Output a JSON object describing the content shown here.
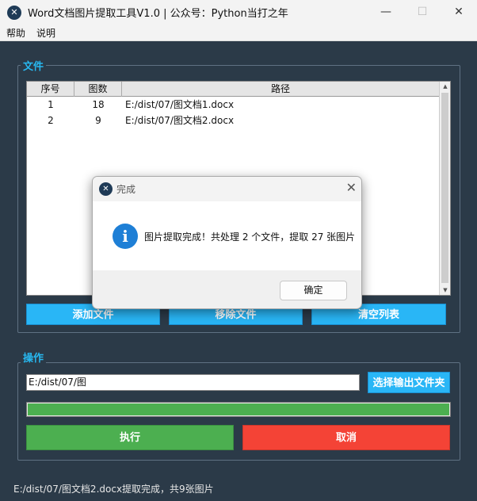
{
  "window": {
    "title": "Word文档图片提取工具V1.0 | 公众号：Python当打之年",
    "app_icon": "app-logo-icon",
    "minimize": "—",
    "maximize": "☐",
    "close": "✕"
  },
  "menu": {
    "items": [
      {
        "label": "帮助"
      },
      {
        "label": "说明"
      }
    ]
  },
  "files_group": {
    "title": "文件",
    "columns": [
      {
        "label": "序号"
      },
      {
        "label": "图数"
      },
      {
        "label": "路径"
      }
    ],
    "rows": [
      {
        "index": "1",
        "count": "18",
        "path": "E:/dist/07/图文档1.docx"
      },
      {
        "index": "2",
        "count": "9",
        "path": "E:/dist/07/图文档2.docx"
      }
    ],
    "buttons": {
      "add": "添加文件",
      "remove": "移除文件",
      "clear": "清空列表"
    }
  },
  "ops_group": {
    "title": "操作",
    "output_path": "E:/dist/07/图",
    "choose_folder": "选择输出文件夹",
    "progress": 1.0,
    "execute": "执行",
    "cancel": "取消"
  },
  "status_text": "E:/dist/07/图文档2.docx提取完成，共9张图片",
  "dialog": {
    "title": "完成",
    "icon": "info-icon",
    "message": "图片提取完成！共处理 2 个文件，提取 27 张图片",
    "ok": "确定",
    "close": "✕"
  },
  "colors": {
    "background": "#2b3a48",
    "accent": "#27b8f0",
    "blue_button": "#29b6f6",
    "green": "#4caf50",
    "red": "#f44336"
  }
}
